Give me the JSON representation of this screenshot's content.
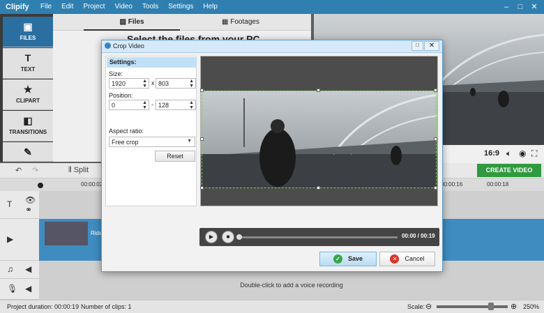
{
  "app": {
    "brand": "Clipify",
    "menu": [
      "File",
      "Edit",
      "Project",
      "Video",
      "Tools",
      "Settings",
      "Help"
    ],
    "window_controls": [
      "–",
      "□",
      "✕"
    ]
  },
  "sidebar": {
    "items": [
      {
        "label": "FILES",
        "icon": "film-icon"
      },
      {
        "label": "TEXT",
        "icon": "text-icon"
      },
      {
        "label": "CLIPART",
        "icon": "star-icon"
      },
      {
        "label": "TRANSITIONS",
        "icon": "transitions-icon"
      },
      {
        "label": "",
        "icon": "magic-wand-icon"
      }
    ]
  },
  "library": {
    "tabs": [
      "Files",
      "Footages"
    ],
    "heading": "Select the files from your PC"
  },
  "preview": {
    "aspect_ratio": "16:9"
  },
  "toolbar": {
    "split_label": "Split",
    "create_label": "CREATE VIDEO"
  },
  "ruler": {
    "ticks": [
      "00:00:02",
      "00:00:16",
      "00:00:18"
    ]
  },
  "timeline": {
    "clip_label": "Ride",
    "voice_hint": "Double-click to add a voice recording"
  },
  "status": {
    "duration": "Project duration: 00:00:19",
    "clips": "Number of clips: 1",
    "scale_label": "Scale:",
    "scale_value": "250%",
    "scale_fraction": 0.7
  },
  "dialog": {
    "title": "Crop Video",
    "settings_header": "Settings:",
    "size_label": "Size:",
    "width": "1920",
    "height": "803",
    "size_sep": "x",
    "position_label": "Position:",
    "pos_x": "0",
    "pos_y": "128",
    "pos_sep": "-",
    "aspect_label": "Aspect ratio:",
    "aspect_value": "Free crop",
    "reset_label": "Reset",
    "timecode": "00:00 / 00:19",
    "save_label": "Save",
    "cancel_label": "Cancel"
  },
  "colors": {
    "accent": "#2f7fb0",
    "create": "#2f9a3f",
    "crop_frame": "#7cd34a"
  }
}
